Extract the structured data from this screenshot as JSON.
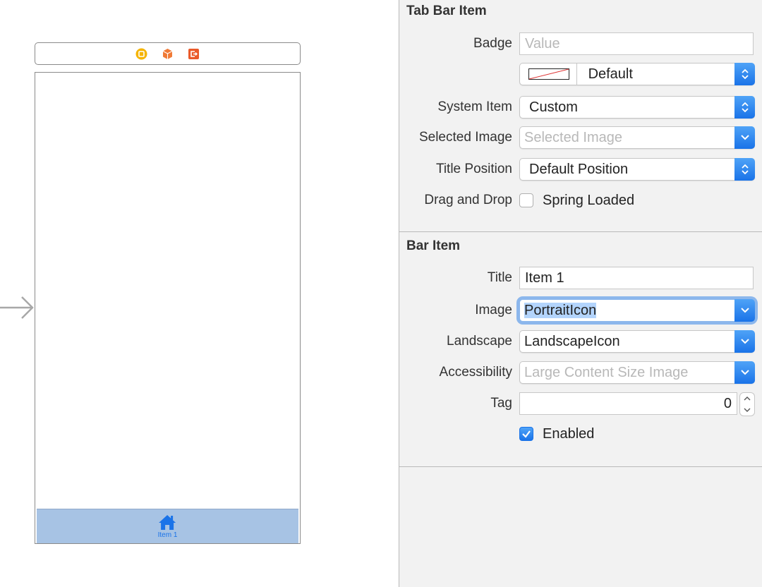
{
  "canvas": {
    "dock_icons": [
      "view-controller-icon",
      "first-responder-icon",
      "exit-icon"
    ],
    "tab_bar": {
      "item_label": "Item 1",
      "item_icon": "home-icon"
    }
  },
  "inspector": {
    "tab_bar_item": {
      "header": "Tab Bar Item",
      "badge": {
        "label": "Badge",
        "placeholder": "Value"
      },
      "badge_color": {
        "value": "Default"
      },
      "system_item": {
        "label": "System Item",
        "value": "Custom"
      },
      "selected_image": {
        "label": "Selected Image",
        "placeholder": "Selected Image"
      },
      "title_position": {
        "label": "Title Position",
        "value": "Default Position"
      },
      "drag_and_drop": {
        "label": "Drag and Drop",
        "checkbox_label": "Spring Loaded",
        "checked": false
      }
    },
    "bar_item": {
      "header": "Bar Item",
      "title": {
        "label": "Title",
        "value": "Item 1"
      },
      "image": {
        "label": "Image",
        "value": "PortraitIcon"
      },
      "landscape": {
        "label": "Landscape",
        "value": "LandscapeIcon"
      },
      "accessibility": {
        "label": "Accessibility",
        "placeholder": "Large Content Size Image"
      },
      "tag": {
        "label": "Tag",
        "value": "0"
      },
      "enabled": {
        "label": "Enabled",
        "checked": true
      }
    }
  },
  "colors": {
    "accent": "#1a73e8",
    "tab_bar_bg": "#a7c3e4",
    "inspector_bg": "#f2f2f2",
    "focus_ring": "#8cb7ec"
  }
}
